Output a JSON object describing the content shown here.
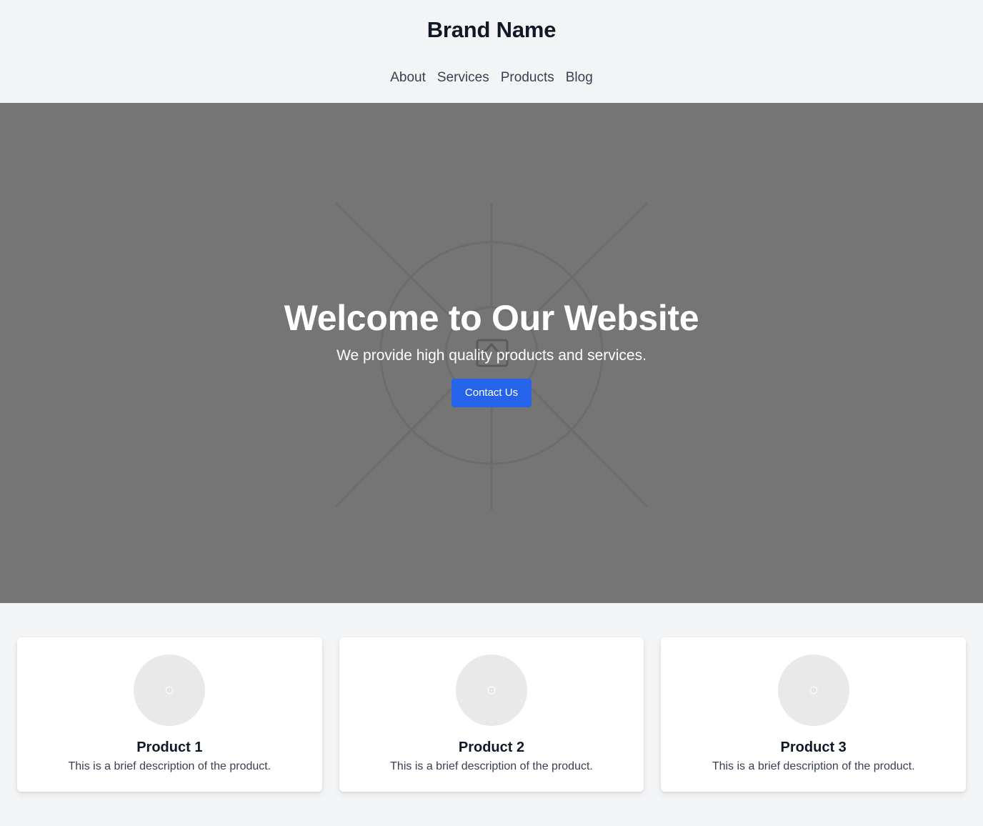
{
  "header": {
    "brand": "Brand Name",
    "nav": [
      {
        "label": "About"
      },
      {
        "label": "Services"
      },
      {
        "label": "Products"
      },
      {
        "label": "Blog"
      }
    ]
  },
  "hero": {
    "title": "Welcome to Our Website",
    "subtitle": "We provide high quality products and services.",
    "button_label": "Contact Us",
    "background_icon": "image-placeholder-icon"
  },
  "products": [
    {
      "name": "Product 1",
      "description": "This is a brief description of the product.",
      "icon": "image-placeholder-icon"
    },
    {
      "name": "Product 2",
      "description": "This is a brief description of the product.",
      "icon": "image-placeholder-icon"
    },
    {
      "name": "Product 3",
      "description": "This is a brief description of the product.",
      "icon": "image-placeholder-icon"
    }
  ],
  "colors": {
    "page_background": "#f3f4f6",
    "hero_background": "#757575",
    "accent": "#2563eb",
    "heading": "#111827",
    "body_text": "#374151"
  }
}
